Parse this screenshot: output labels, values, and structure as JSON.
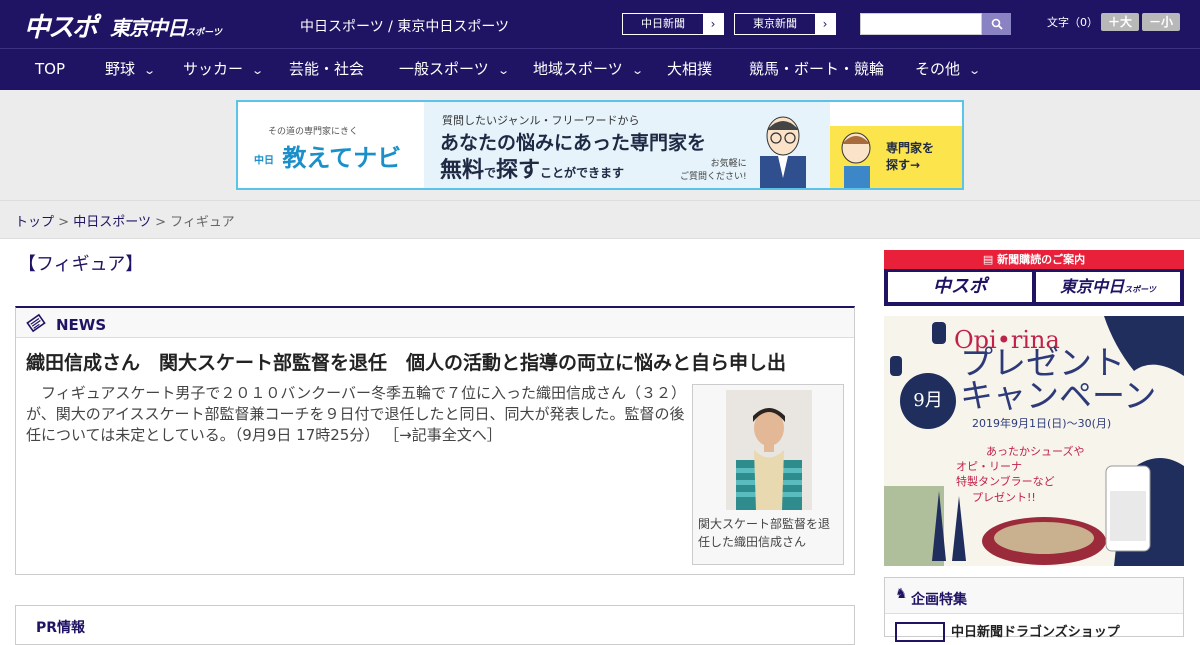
{
  "header": {
    "logo_main": "中スポ",
    "logo_tokyo": "東京中日",
    "logo_tokyo_sub": "スポーツ",
    "site_links": "中日スポーツ / 東京中日スポーツ",
    "chunichi_btn": "中日新聞",
    "tokyo_btn": "東京新聞",
    "search_placeholder": "",
    "fontsize_label": "文字（0）",
    "font_up": "＋大",
    "font_down": "－小"
  },
  "nav": {
    "items": [
      {
        "label": "TOP"
      },
      {
        "label": "野球"
      },
      {
        "label": "サッカー"
      },
      {
        "label": "芸能・社会"
      },
      {
        "label": "一般スポーツ"
      },
      {
        "label": "地域スポーツ"
      },
      {
        "label": "大相撲"
      },
      {
        "label": "競馬・ボート・競輪"
      },
      {
        "label": "その他"
      }
    ]
  },
  "ad": {
    "tagline": "その道の専門家にきく",
    "brand": "教えてナビ",
    "brand_prefix": "中日",
    "line1": "質問したいジャンル・フリーワードから",
    "line2": "あなたの悩みにあった専門家を",
    "line3_a": "無料",
    "line3_b": "で",
    "line3_c": "探す",
    "line3_d": "ことができます",
    "note1": "お気軽に",
    "note2": "ご質問ください!",
    "cta1": "専門家を",
    "cta2": "探す→"
  },
  "breadcrumb": {
    "home": "トップ",
    "section": "中日スポーツ",
    "current": "フィギュア",
    "sep": ">"
  },
  "page": {
    "title": "【フィギュア】"
  },
  "news": {
    "label": "NEWS",
    "title": "織田信成さん　関大スケート部監督を退任　個人の活動と指導の両立に悩みと自ら申し出",
    "body": "　フィギュアスケート男子で２０１０バンクーバー冬季五輪で７位に入った織田信成さん（３２）が、関大のアイススケート部監督兼コーチを９日付で退任したと同日、同大が発表した。監督の後任については未定としている。（9月9日 17時25分）",
    "more": "［→記事全文へ］",
    "photo_caption": "関大スケート部監督を退任した織田信成さん"
  },
  "pr": {
    "label": "PR情報"
  },
  "sidebar": {
    "subscribe_head": "新聞購読のご案内",
    "sub_logo1": "中スポ",
    "sub_logo2": "東京中日",
    "sub_logo2_small": "スポーツ",
    "campaign_brand": "Opi•rina",
    "campaign_h1": "プレゼント",
    "campaign_h2": "キャンペーン",
    "campaign_dates": "2019年9月1日(日)〜30(月)",
    "campaign_month": "9月",
    "campaign_gift1": "あったかシューズや",
    "campaign_gift2": "オピ・リーナ",
    "campaign_gift3": "特製タンブラーなど",
    "campaign_gift4": "プレゼント!!",
    "feature_label": "企画特集",
    "feature_item": "中日新聞ドラゴンズショップ"
  }
}
